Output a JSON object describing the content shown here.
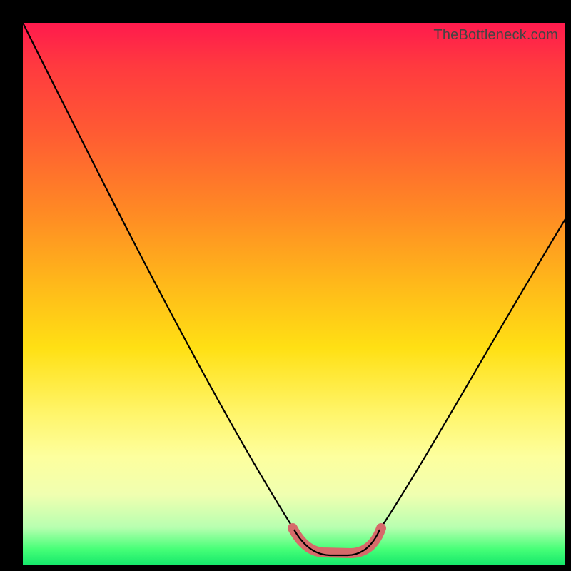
{
  "watermark": "TheBottleneck.com",
  "chart_data": {
    "type": "line",
    "title": "",
    "xlabel": "",
    "ylabel": "",
    "xlim": [
      0,
      100
    ],
    "ylim": [
      0,
      100
    ],
    "grid": false,
    "legend": false,
    "series": [
      {
        "name": "bottleneck-curve",
        "x": [
          0,
          5,
          10,
          15,
          20,
          25,
          30,
          35,
          40,
          45,
          50,
          53,
          56,
          60,
          63,
          66,
          70,
          75,
          80,
          85,
          90,
          95,
          100
        ],
        "values": [
          100,
          91,
          82,
          73,
          64,
          55,
          46,
          37,
          28,
          19,
          10,
          5,
          2,
          1,
          1,
          2,
          6,
          14,
          24,
          34,
          44,
          54,
          64
        ]
      },
      {
        "name": "highlight-minimum",
        "x": [
          50,
          53,
          56,
          60,
          63,
          66
        ],
        "values": [
          8,
          4,
          2,
          1,
          2,
          5
        ]
      }
    ],
    "background_gradient": {
      "top": "#ff1a4d",
      "mid": "#ffe014",
      "bottom": "#14e86a"
    }
  }
}
